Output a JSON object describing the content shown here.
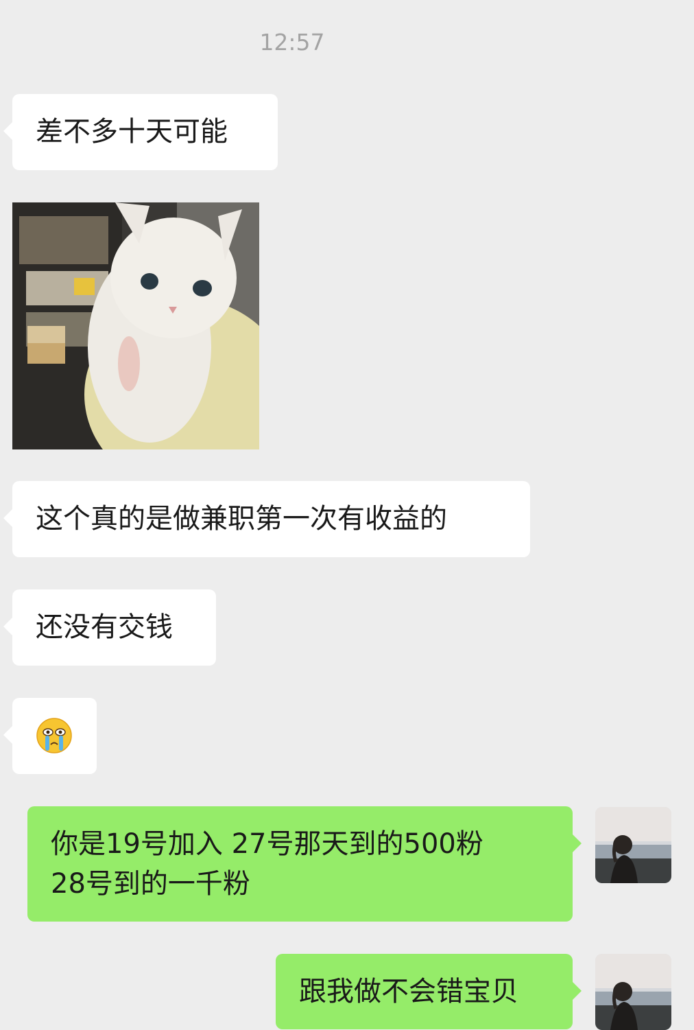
{
  "chat": {
    "timestamp": "12:57",
    "messages": [
      {
        "side": "in",
        "type": "text",
        "text": "差不多十天可能"
      },
      {
        "side": "in",
        "type": "image",
        "icon": "cat-photo"
      },
      {
        "side": "in",
        "type": "text",
        "text": "这个真的是做兼职第一次有收益的"
      },
      {
        "side": "in",
        "type": "text",
        "text": "还没有交钱"
      },
      {
        "side": "in",
        "type": "emoji",
        "icon": "crying-face-emoji"
      },
      {
        "side": "out",
        "type": "text",
        "lines": [
          "你是19号加入 27号那天到的500粉",
          "28号到的一千粉"
        ]
      },
      {
        "side": "out",
        "type": "text",
        "text": "跟我做不会错宝贝"
      }
    ]
  },
  "colors": {
    "background": "#ededed",
    "incoming_bubble": "#ffffff",
    "outgoing_bubble": "#95ec69",
    "timestamp": "#a3a3a3"
  }
}
